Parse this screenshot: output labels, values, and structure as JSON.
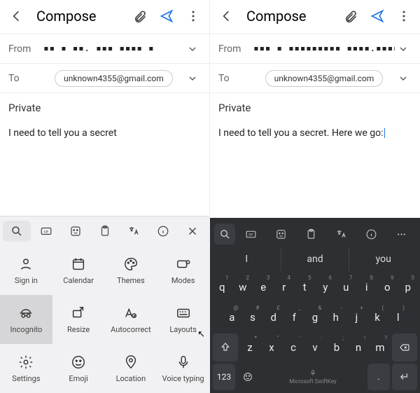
{
  "left": {
    "header": {
      "title": "Compose"
    },
    "from_label": "From",
    "from_value": "▪▪  ▪ ▪▪.  ▪▪▪  ▪▪▪▪  ▪",
    "to_label": "To",
    "to_chip": "unknown4355@gmail.com",
    "subject": "Private",
    "body": "I need to tell you a secret",
    "grid": {
      "signin": "Sign in",
      "calendar": "Calendar",
      "themes": "Themes",
      "modes": "Modes",
      "incognito": "Incognito",
      "resize": "Resize",
      "autocorrect": "Autocorrect",
      "layouts": "Layouts",
      "settings": "Settings",
      "emoji": "Emoji",
      "location": "Location",
      "voice": "Voice typing"
    }
  },
  "right": {
    "header": {
      "title": "Compose"
    },
    "from_label": "From",
    "from_value": "▪▪▪ ▪ ▪▪▪▪▪▪▪▪▪ ▪▪▪▪.▪▪▪▪",
    "to_label": "To",
    "to_chip": "unknown4355@gmail.com",
    "subject": "Private",
    "body": "I need to tell you a secret. Here we go:",
    "suggestions": [
      "I",
      "and",
      "you"
    ],
    "rows": {
      "r1": [
        "q",
        "w",
        "e",
        "r",
        "t",
        "y",
        "u",
        "i",
        "o",
        "p"
      ],
      "r1alt": [
        "1",
        "2",
        "3",
        "4",
        "5",
        "6",
        "7",
        "8",
        "9",
        "0"
      ],
      "r2": [
        "a",
        "s",
        "d",
        "f",
        "g",
        "h",
        "j",
        "k",
        "l"
      ],
      "r2alt": [
        "@",
        "#",
        "£",
        "_",
        "&",
        "-",
        "+",
        "(",
        ")"
      ],
      "r3": [
        "z",
        "x",
        "c",
        "v",
        "b",
        "n",
        "m"
      ],
      "r3alt": [
        "*",
        "\"",
        "'",
        ":",
        ";",
        "!",
        "?"
      ]
    },
    "mode_key": "123",
    "spacebar_brand": "Microsoft SwiftKey"
  }
}
